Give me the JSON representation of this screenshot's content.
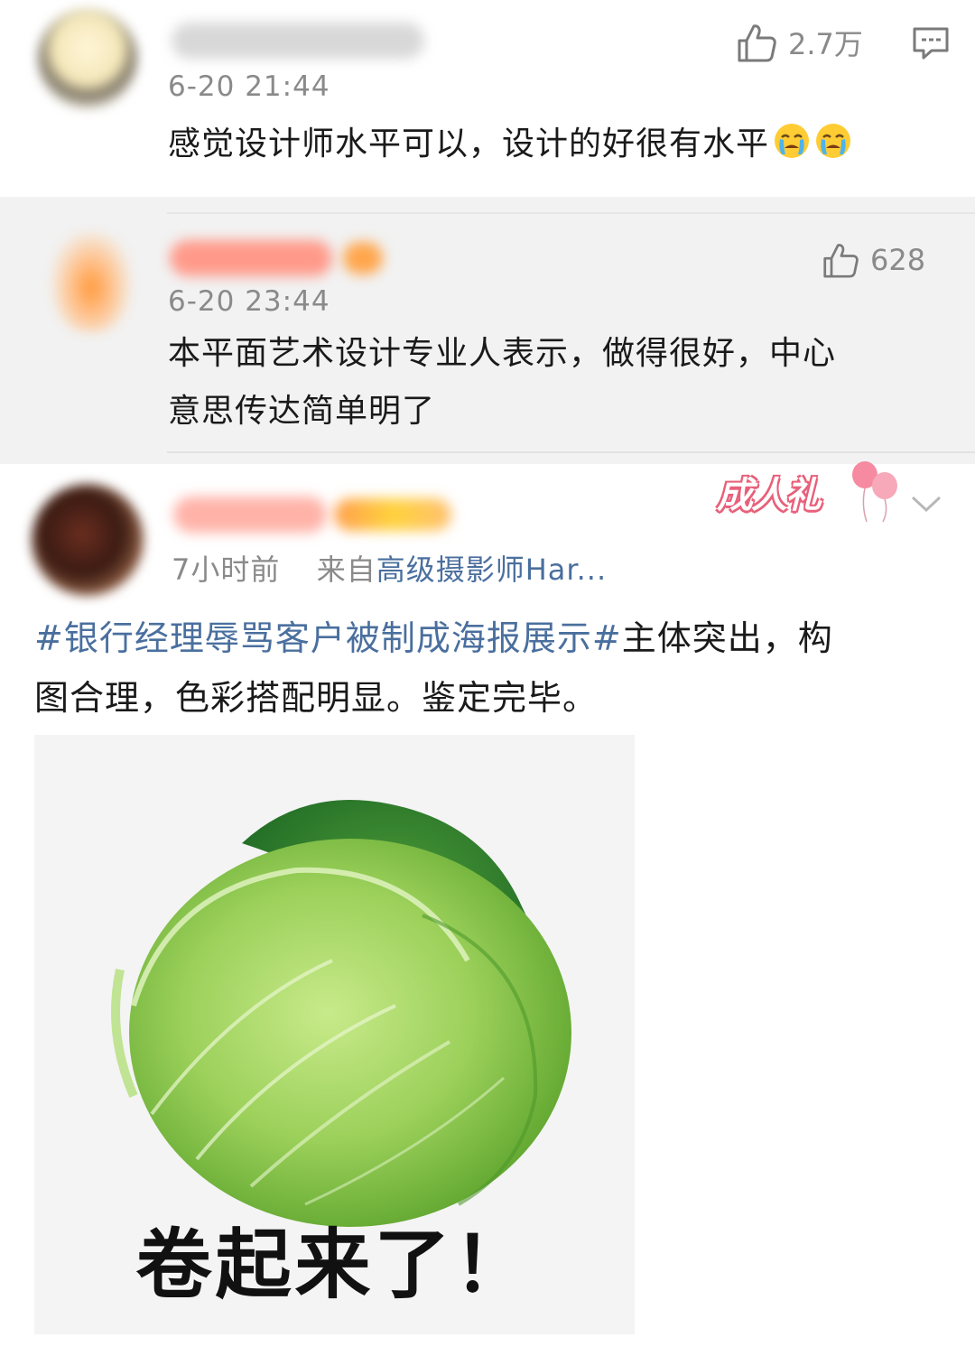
{
  "comment1": {
    "time": "6-20 21:44",
    "like_count": "2.7万",
    "text": "感觉设计师水平可以，设计的好很有水平",
    "emojis": [
      "crying-emoji",
      "crying-emoji"
    ]
  },
  "reply1": {
    "time": "6-20 23:44",
    "like_count": "628",
    "text_line1": "本平面艺术设计专业人表示，做得很好，中心",
    "text_line2": "意思传达简单明了"
  },
  "post": {
    "time": "7小时前",
    "source_prefix": "来自",
    "source_name": "高级摄影师Har...",
    "badge_text": "成人礼",
    "hashtag": "#银行经理辱骂客户被制成海报展示#",
    "body_after_hashtag": "主体突出，构",
    "body_line2": "图合理，色彩搭配明显。鉴定完毕。",
    "image": {
      "subject": "cabbage",
      "caption": "卷起来了！"
    }
  },
  "colors": {
    "link": "#4a6f9e",
    "muted": "#8a8a8a",
    "reply_bg": "#f2f2f2",
    "badge": "#e8607a"
  }
}
